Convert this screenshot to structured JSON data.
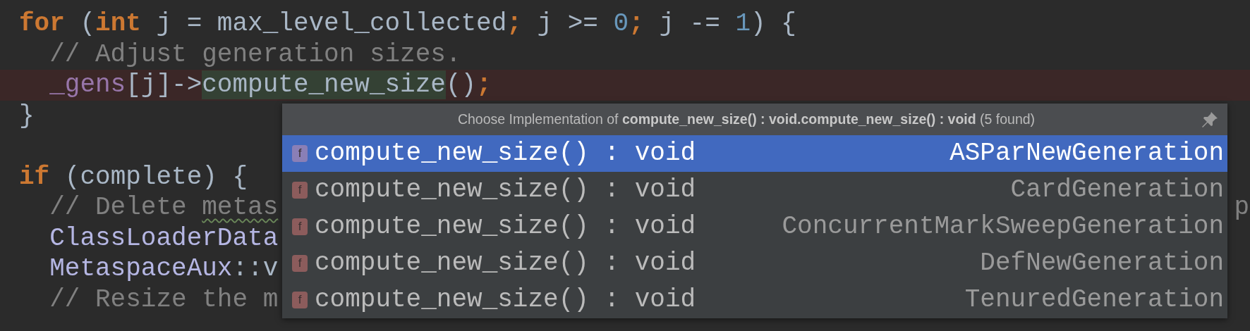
{
  "editor": {
    "lines": [
      {
        "tokens": [
          {
            "text": "for",
            "kind": "keyword"
          },
          {
            "text": " (",
            "kind": "plain"
          },
          {
            "text": "int",
            "kind": "keyword"
          },
          {
            "text": " j = max_level_collected",
            "kind": "plain"
          },
          {
            "text": ";",
            "kind": "keyword"
          },
          {
            "text": " j >= ",
            "kind": "plain"
          },
          {
            "text": "0",
            "kind": "number"
          },
          {
            "text": ";",
            "kind": "keyword"
          },
          {
            "text": " j -= ",
            "kind": "plain"
          },
          {
            "text": "1",
            "kind": "number"
          },
          {
            "text": ") {",
            "kind": "plain"
          }
        ]
      },
      {
        "tokens": [
          {
            "text": "  // Adjust generation sizes.",
            "kind": "comment"
          }
        ]
      },
      {
        "highlighted": true,
        "tokens": [
          {
            "text": "  _gens",
            "kind": "field"
          },
          {
            "text": "[j]->",
            "kind": "plain"
          },
          {
            "text": "compute_new_size",
            "kind": "plain",
            "usage": true
          },
          {
            "text": "()",
            "kind": "plain"
          },
          {
            "text": ";",
            "kind": "keyword"
          }
        ]
      },
      {
        "tokens": [
          {
            "text": "}",
            "kind": "plain"
          }
        ]
      },
      {
        "blank_line_before": true,
        "tokens": [
          {
            "text": "if",
            "kind": "keyword"
          },
          {
            "text": " (complete) {",
            "kind": "plain"
          }
        ]
      },
      {
        "tokens": [
          {
            "text": "  // Delete ",
            "kind": "comment"
          },
          {
            "text": "metas",
            "kind": "comment",
            "typo": true
          }
        ],
        "right_fragment": "p"
      },
      {
        "tokens": [
          {
            "text": "  ClassLoaderData",
            "kind": "type"
          }
        ]
      },
      {
        "tokens": [
          {
            "text": "  MetaspaceAux",
            "kind": "type"
          },
          {
            "text": "::v",
            "kind": "plain"
          }
        ]
      },
      {
        "tokens": [
          {
            "text": "  // Resize the m",
            "kind": "comment"
          }
        ]
      }
    ]
  },
  "popup": {
    "title": "Choose Implementation of **compute_new_size() : void.compute_new_size() : void** (5 found)",
    "items": [
      {
        "icon_letter": "f",
        "signature": "compute_new_size() : void",
        "class": "ASParNewGeneration",
        "selected": true
      },
      {
        "icon_letter": "f",
        "signature": "compute_new_size() : void",
        "class": "CardGeneration",
        "selected": false
      },
      {
        "icon_letter": "f",
        "signature": "compute_new_size() : void",
        "class": "ConcurrentMarkSweepGeneration",
        "selected": false
      },
      {
        "icon_letter": "f",
        "signature": "compute_new_size() : void",
        "class": "DefNewGeneration",
        "selected": false
      },
      {
        "icon_letter": "f",
        "signature": "compute_new_size() : void",
        "class": "TenuredGeneration",
        "selected": false
      }
    ]
  }
}
